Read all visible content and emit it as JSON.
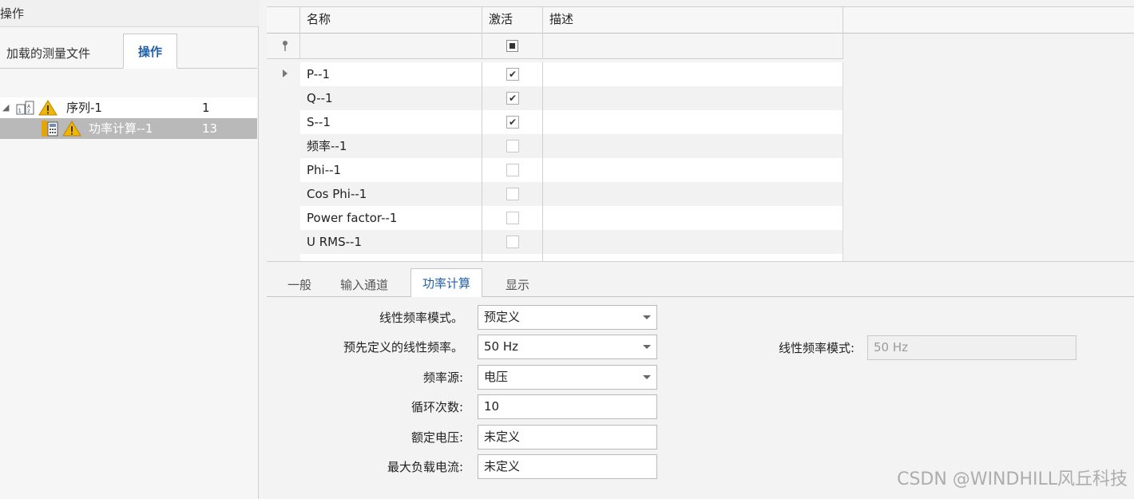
{
  "left_panel": {
    "title": "操作",
    "tabs": [
      "加载的测量文件",
      "操作"
    ],
    "tree": [
      {
        "label": "序列-1",
        "count": "1"
      },
      {
        "label": "功率计算--1",
        "count": "13"
      }
    ]
  },
  "grid": {
    "columns": [
      "名称",
      "激活",
      "描述"
    ],
    "rows": [
      {
        "name": "P--1",
        "active": true,
        "description": ""
      },
      {
        "name": "Q--1",
        "active": true,
        "description": ""
      },
      {
        "name": "S--1",
        "active": true,
        "description": ""
      },
      {
        "name": "频率--1",
        "active": false,
        "description": ""
      },
      {
        "name": "Phi--1",
        "active": false,
        "description": ""
      },
      {
        "name": "Cos Phi--1",
        "active": false,
        "description": ""
      },
      {
        "name": "Power factor--1",
        "active": false,
        "description": ""
      },
      {
        "name": "U RMS--1",
        "active": false,
        "description": ""
      }
    ]
  },
  "bottom_tabs": [
    "一般",
    "输入通道",
    "功率计算",
    "显示"
  ],
  "active_bottom_tab": "功率计算",
  "form": {
    "fields": [
      {
        "label": "线性频率模式。",
        "value": "预定义",
        "type": "dropdown"
      },
      {
        "label": "预先定义的线性频率。",
        "value": "50 Hz",
        "type": "dropdown"
      },
      {
        "label": "频率源:",
        "value": "电压",
        "type": "dropdown"
      },
      {
        "label": "循环次数:",
        "value": "10",
        "type": "text"
      },
      {
        "label": "额定电压:",
        "value": "未定义",
        "type": "text"
      },
      {
        "label": "最大负载电流:",
        "value": "未定义",
        "type": "text"
      }
    ],
    "side_field": {
      "label": "线性频率模式:",
      "value": "50 Hz",
      "disabled": true
    }
  },
  "watermark": "CSDN @WINDHILL风丘科技",
  "colors": {
    "accent": "#1f5fa8",
    "selected_row": "#b9b9b9",
    "warning": "#e8a800"
  }
}
